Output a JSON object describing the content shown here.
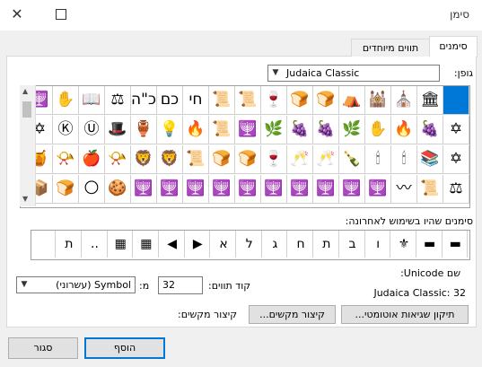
{
  "window": {
    "title": "סימן",
    "close_glyph": "✕",
    "maximize_glyph": ""
  },
  "tabs": [
    {
      "label": "סימנים",
      "active": true
    },
    {
      "label": "תווים מיוחדים",
      "active": false
    }
  ],
  "font": {
    "label": "גופן:",
    "value": "Judaica Classic"
  },
  "symbol_grid": {
    "rows": [
      [
        "",
        "🏛",
        "⛪",
        "🕍",
        "⛺",
        "🍞",
        "🍞",
        "🍷",
        "📜",
        "📜",
        "חי",
        "כם",
        "כ\"ה",
        "⚖",
        "📖",
        "✋",
        "🕎",
        "🥂",
        ""
      ],
      [
        "✡",
        "🍇",
        "🔥",
        "✋",
        "🌿",
        "🍇",
        "🍇",
        "🌿",
        "🕎",
        "📜",
        "🔥",
        "💡",
        "🏺",
        "🎩",
        "Ⓤ",
        "Ⓚ",
        "✡",
        "✡",
        ""
      ],
      [
        "✡",
        "📚",
        "🕯",
        "🕯",
        "🍾",
        "🥂",
        "🥂",
        "🍷",
        "🍞",
        "🍞",
        "📜",
        "🦁",
        "🦁",
        "📯",
        "🍎",
        "📯",
        "🍯",
        ""
      ],
      [
        "⚖",
        "📜",
        "〰",
        "🕎",
        "🕎",
        "🕎",
        "🕎",
        "🕎",
        "🕎",
        "🕎",
        "🕎",
        "🕎",
        "🕎",
        "🍪",
        "🌕",
        "🍞",
        "📦",
        "🔥"
      ]
    ]
  },
  "recent": {
    "label": "סימנים שהיו בשימוש לאחרונה:",
    "symbols": [
      "▬",
      "▬",
      "⚜",
      "ו",
      "ב",
      "ת",
      "ח",
      "ג",
      "ל",
      "א",
      "▶",
      "◀",
      "▦",
      "▦",
      "..",
      "ת",
      ""
    ]
  },
  "unicode": {
    "name_label": "שם Unicode:",
    "name_value": "Judaica Classic: 32"
  },
  "char_code": {
    "label": "קוד תווים:",
    "value": "32",
    "from_label": "מ:",
    "from_value": "Symbol (עשרוני)"
  },
  "buttons": {
    "autocorrect": "תיקון שגיאות אוטומטי...",
    "shortcut_key": "קיצור מקשים...",
    "shortcut_label": "קיצור מקשים:",
    "insert": "הוסף",
    "close": "סגור"
  }
}
